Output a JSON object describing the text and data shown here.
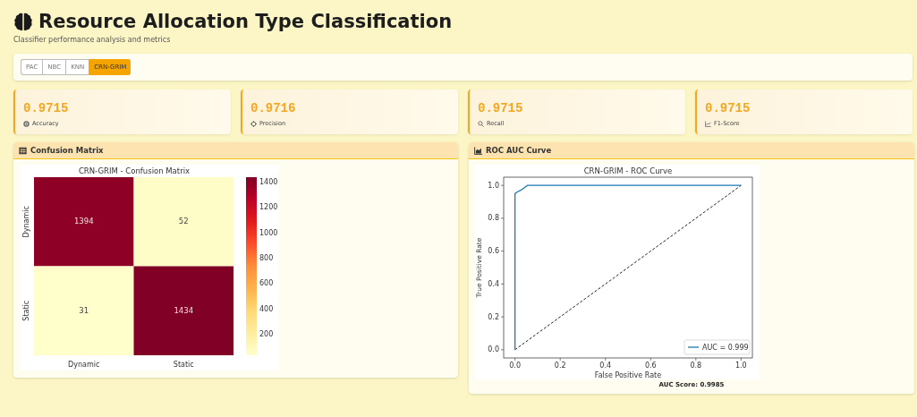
{
  "header": {
    "title": "Resource Allocation Type Classification",
    "subtitle": "Classifier performance analysis and metrics"
  },
  "tabs": [
    {
      "label": "PAC",
      "selected": false
    },
    {
      "label": "NBC",
      "selected": false
    },
    {
      "label": "KNN",
      "selected": false
    },
    {
      "label": "CRN-GRIM",
      "selected": true
    }
  ],
  "metrics": [
    {
      "kind": "accuracy",
      "value": "0.9715",
      "label": "Accuracy"
    },
    {
      "kind": "precision",
      "value": "0.9716",
      "label": "Precision"
    },
    {
      "kind": "recall",
      "value": "0.9715",
      "label": "Recall"
    },
    {
      "kind": "f1",
      "value": "0.9715",
      "label": "F1-Score"
    }
  ],
  "confusion_matrix": {
    "heading": "Confusion Matrix",
    "title": "CRN-GRIM - Confusion Matrix",
    "row_labels": [
      "Dynamic",
      "Static"
    ],
    "column_labels": [
      "Dynamic",
      "Static"
    ],
    "cells": [
      [
        "1394",
        "52"
      ],
      [
        "31",
        "1434"
      ]
    ],
    "colorbar_ticks": [
      "1400",
      "1200",
      "1000",
      "800",
      "600",
      "400",
      "200"
    ]
  },
  "roc": {
    "heading": "ROC AUC Curve",
    "baseline": true,
    "score": "AUC Score: 0.9985",
    "chart_data": {
      "type": "line",
      "title": "CRN-GRIM - ROC Curve",
      "xlabel": "False Positive Rate",
      "ylabel": "True Positive Rate",
      "x": [
        0,
        0,
        0.01,
        0.025,
        0.04,
        0.055,
        1
      ],
      "series": [
        {
          "name": "AUC = 0.999",
          "color": "#1f77b4",
          "values": [
            0,
            0.95,
            0.96,
            0.97,
            0.985,
            1,
            1
          ]
        }
      ],
      "xlim": [
        -0.05,
        1.05
      ],
      "ylim": [
        -0.05,
        1.05
      ],
      "xticks": [
        {
          "value": 0,
          "label": "0.0"
        },
        {
          "value": 0.2,
          "label": "0.2"
        },
        {
          "value": 0.4,
          "label": "0.4"
        },
        {
          "value": 0.6,
          "label": "0.6"
        },
        {
          "value": 0.8,
          "label": "0.8"
        },
        {
          "value": 1,
          "label": "1.0"
        }
      ],
      "yticks": [
        {
          "value": 0,
          "label": "0.0"
        },
        {
          "value": 0.2,
          "label": "0.2"
        },
        {
          "value": 0.4,
          "label": "0.4"
        },
        {
          "value": 0.6,
          "label": "0.6"
        },
        {
          "value": 0.8,
          "label": "0.8"
        },
        {
          "value": 1,
          "label": "1.0"
        }
      ]
    }
  }
}
